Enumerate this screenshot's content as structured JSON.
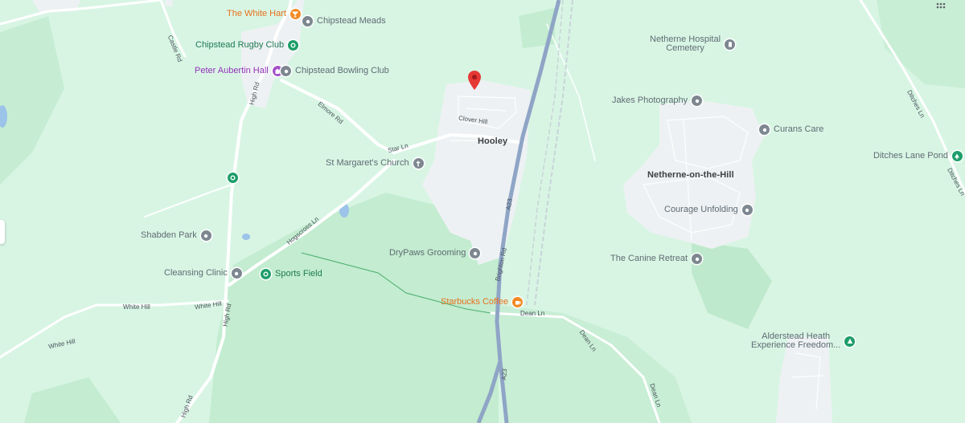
{
  "places": [
    {
      "name": "Hooley"
    },
    {
      "name": "Netherne-on-the-Hill"
    }
  ],
  "pois": [
    {
      "name": "The White Hart",
      "icon": "cocktail-icon",
      "color": "orange"
    },
    {
      "name": "Chipstead Meads",
      "icon": "location-icon",
      "color": "grey"
    },
    {
      "name": "Chipstead Rugby Club",
      "icon": "sports-icon",
      "color": "green"
    },
    {
      "name": "Peter Aubertin Hall",
      "icon": "hall-icon",
      "color": "purple"
    },
    {
      "name": "Chipstead Bowling Club",
      "icon": "location-icon",
      "color": "grey"
    },
    {
      "name": "St Margaret's Church",
      "icon": "church-icon",
      "color": "grey"
    },
    {
      "name": "Shabden Park",
      "icon": "location-icon",
      "color": "grey"
    },
    {
      "name": "Cleansing Clinic",
      "icon": "location-icon",
      "color": "grey"
    },
    {
      "name": "Sports Field",
      "icon": "sports-icon",
      "color": "green"
    },
    {
      "name": "DryPaws Grooming",
      "icon": "location-icon",
      "color": "grey"
    },
    {
      "name": "Starbucks Coffee",
      "icon": "coffee-icon",
      "color": "orange"
    },
    {
      "name": "Netherne Hospital Cemetery",
      "line1": "Netherne Hospital",
      "line2": "Cemetery",
      "icon": "cemetery-icon",
      "color": "grey"
    },
    {
      "name": "Jakes Photography",
      "icon": "location-icon",
      "color": "grey"
    },
    {
      "name": "Curans Care",
      "icon": "location-icon",
      "color": "grey"
    },
    {
      "name": "Courage Unfolding",
      "icon": "location-icon",
      "color": "grey"
    },
    {
      "name": "The Canine Retreat",
      "icon": "location-icon",
      "color": "grey"
    },
    {
      "name": "Ditches Lane Pond",
      "icon": "tree-icon",
      "color": "green"
    },
    {
      "name": "Alderstead Heath Experience Freedom...",
      "line1": "Alderstead Heath",
      "line2": "Experience Freedom...",
      "icon": "park-icon",
      "color": "green"
    }
  ],
  "streets": [
    "Castle Rd",
    "High Rd",
    "Elmore Rd",
    "Star Ln",
    "Clover Hill",
    "Hogscross Ln",
    "White Hill",
    "White Hill",
    "White Hill",
    "High Rd",
    "High Rd",
    "A23",
    "A23",
    "Brighton Rd",
    "Dean Ln",
    "Dean Ln",
    "Dean Ln",
    "Ditches Ln",
    "Ditches Ln"
  ],
  "colors": {
    "land": "#d8f5e4",
    "park": "#c3ecd0",
    "urban": "#eef1f3",
    "motorway": "#8fa5c6",
    "marker": "#e53935"
  }
}
